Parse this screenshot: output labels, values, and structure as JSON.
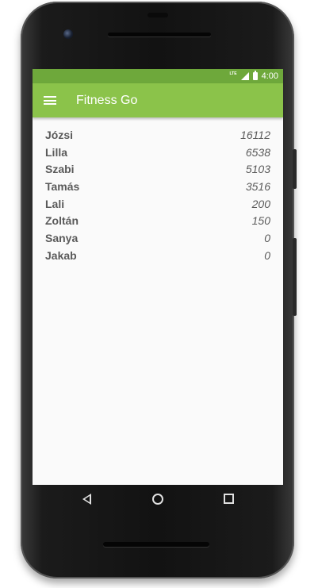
{
  "status_bar": {
    "network": "LTE",
    "time": "4:00"
  },
  "app_bar": {
    "title": "Fitness Go",
    "menu_icon": "hamburger-menu-icon"
  },
  "leaderboard": [
    {
      "name": "Józsi",
      "score": "16112"
    },
    {
      "name": "Lilla",
      "score": "6538"
    },
    {
      "name": "Szabi",
      "score": "5103"
    },
    {
      "name": "Tamás",
      "score": "3516"
    },
    {
      "name": "Lali",
      "score": "200"
    },
    {
      "name": "Zoltán",
      "score": "150"
    },
    {
      "name": "Sanya",
      "score": "0"
    },
    {
      "name": "Jakab",
      "score": "0"
    }
  ],
  "nav_bar": {
    "back_icon": "back-triangle-icon",
    "home_icon": "home-circle-icon",
    "recents_icon": "recents-square-icon"
  },
  "colors": {
    "primary": "#8bc34a",
    "primary_dark": "#6ea83b",
    "text": "#5a5a5a"
  }
}
